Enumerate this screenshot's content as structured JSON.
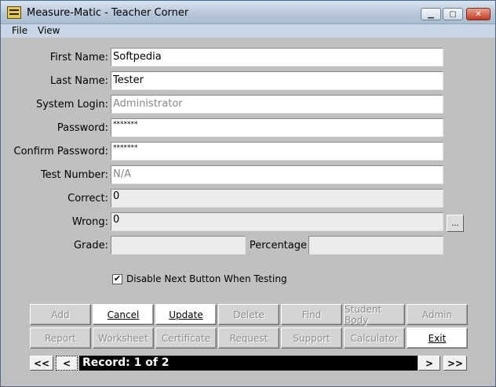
{
  "window": {
    "title": "Measure-Matic - Teacher Corner"
  },
  "menu": {
    "file": "File",
    "view": "View"
  },
  "form": {
    "first_name_label": "First Name:",
    "first_name": "Softpedia",
    "last_name_label": "Last Name:",
    "last_name": "Tester",
    "system_login_label": "System Login:",
    "system_login": "Administrator",
    "password_label": "Password:",
    "password": "*******",
    "confirm_password_label": "Confirm Password:",
    "confirm_password": "*******",
    "test_number_label": "Test Number:",
    "test_number": "N/A",
    "correct_label": "Correct:",
    "correct": "0",
    "wrong_label": "Wrong:",
    "wrong": "0",
    "wrong_lookup": "...",
    "grade_label": "Grade:",
    "grade": "",
    "percentage_label": "Percentage",
    "percentage": ""
  },
  "options": {
    "disable_next_label": "Disable Next Button When Testing",
    "disable_next_checked": true,
    "check_mark": "✔"
  },
  "buttons_row1": [
    {
      "label": "Add",
      "enabled": false
    },
    {
      "label": "Cancel",
      "enabled": true
    },
    {
      "label": "Update",
      "enabled": true
    },
    {
      "label": "Delete",
      "enabled": false
    },
    {
      "label": "Find",
      "enabled": false
    },
    {
      "label": "Student Body",
      "enabled": false
    },
    {
      "label": "Admin",
      "enabled": false
    }
  ],
  "buttons_row2": [
    {
      "label": "Report",
      "enabled": false
    },
    {
      "label": "Worksheet",
      "enabled": false
    },
    {
      "label": "Certificate",
      "enabled": false
    },
    {
      "label": "Request",
      "enabled": false
    },
    {
      "label": "Support",
      "enabled": false
    },
    {
      "label": "Calculator",
      "enabled": false
    },
    {
      "label": "Exit",
      "enabled": true
    }
  ],
  "navigation": {
    "first": "<<",
    "prev": "<",
    "next": ">",
    "last": ">>",
    "record_text": "Record: 1 of 2"
  }
}
